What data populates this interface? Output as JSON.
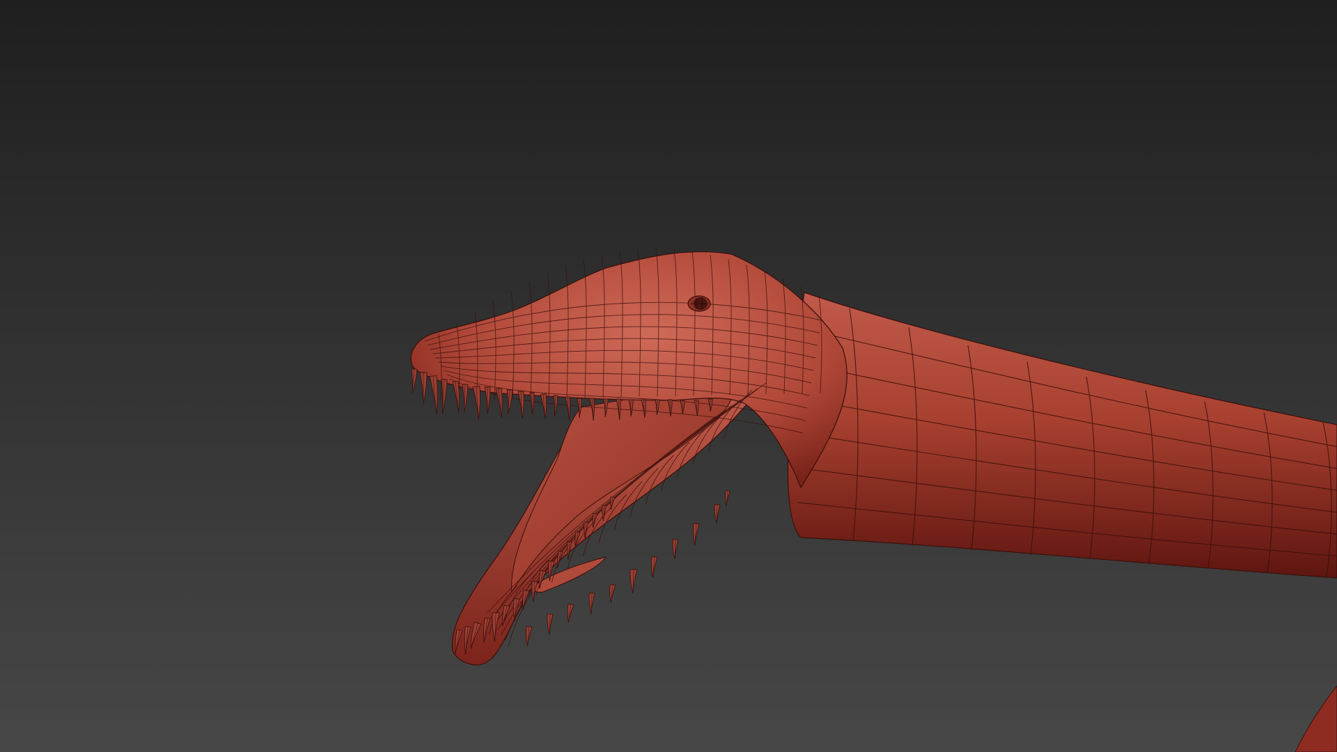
{
  "scene": {
    "background_top": "#1f1f1f",
    "background_bottom": "#474747",
    "model_base_color": "#b3473a",
    "model_highlight_color": "#cf6a58",
    "model_shadow_color": "#6e1a14",
    "wire_color": "#3a0f0b",
    "tooth_color": "#9a3f34",
    "tooth_dark_color": "#3d120d",
    "model_subject": "plesiosaur-head-wireframe-model"
  }
}
